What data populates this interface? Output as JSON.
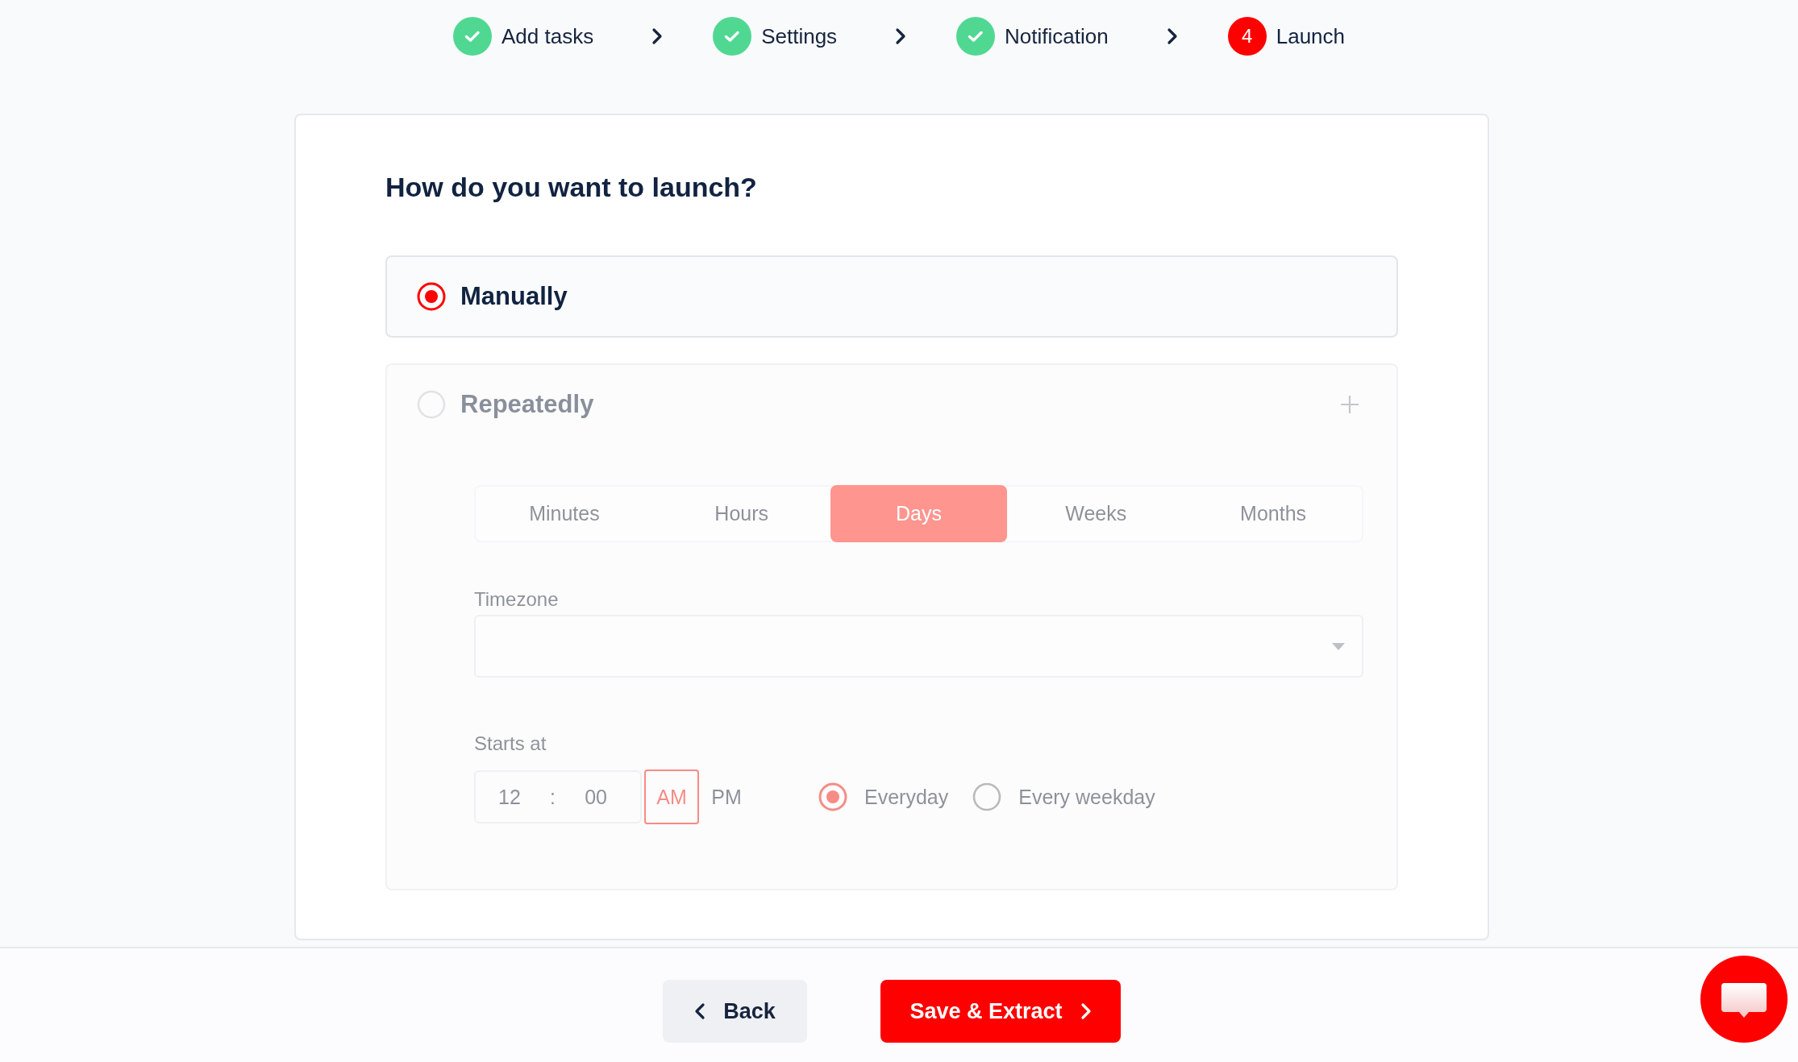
{
  "stepper": [
    {
      "label": "Add tasks",
      "completed": true
    },
    {
      "label": "Settings",
      "completed": true
    },
    {
      "label": "Notification",
      "completed": true
    },
    {
      "label": "Launch",
      "completed": false,
      "number": "4"
    }
  ],
  "launch": {
    "title": "How do you want to launch?",
    "options": [
      {
        "label": "Manually",
        "kind": "simple",
        "selected": true,
        "disabled": false
      },
      {
        "label": "Repeatedly",
        "kind": "schedule",
        "selected": false,
        "disabled": true,
        "schedule": {
          "intervals": [
            {
              "label": "Minutes",
              "selected": false
            },
            {
              "label": "Hours",
              "selected": false
            },
            {
              "label": "Days",
              "selected": true
            },
            {
              "label": "Weeks",
              "selected": false
            },
            {
              "label": "Months",
              "selected": false
            }
          ],
          "timezone": {
            "label": "Timezone"
          },
          "starts_at": {
            "label": "Starts at",
            "hour": "12",
            "separator": ":",
            "minute": "00",
            "periods": [
              {
                "label": "AM",
                "selected": true
              },
              {
                "label": "PM",
                "selected": false
              }
            ],
            "frequency": [
              {
                "label": "Everyday",
                "selected": true
              },
              {
                "label": "Every weekday",
                "selected": false
              }
            ]
          }
        }
      }
    ]
  },
  "footer": {
    "buttons": [
      {
        "label": "Back",
        "kind": "back"
      },
      {
        "label": "Save & Extract",
        "kind": "primary"
      }
    ]
  }
}
